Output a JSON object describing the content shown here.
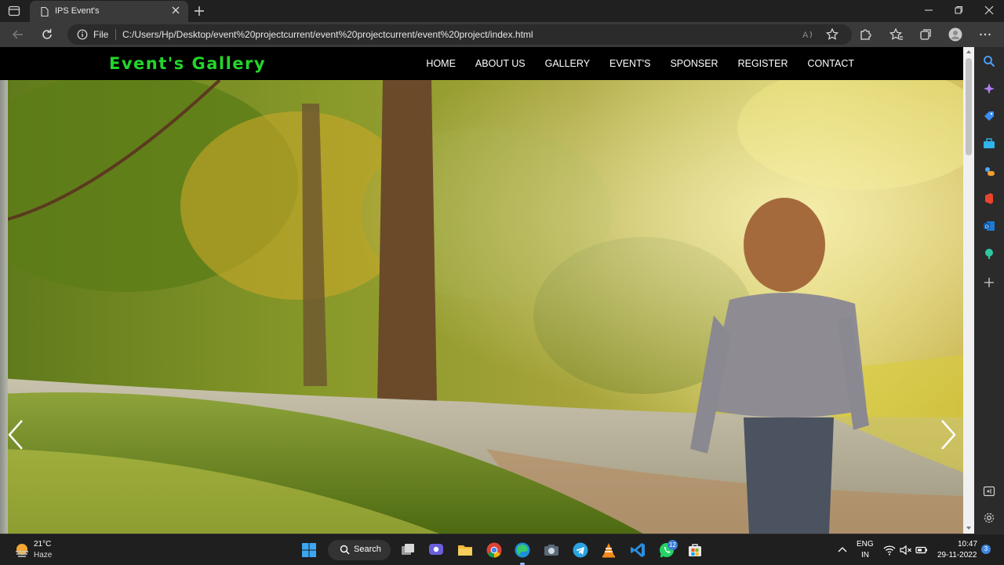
{
  "browser": {
    "tab": {
      "title": "IPS Event's"
    },
    "address": {
      "scheme_label": "File",
      "url": "C:/Users/Hp/Desktop/event%20projectcurrent/event%20projectcurrent/event%20project/index.html"
    }
  },
  "site": {
    "brand": "Event's Gallery",
    "nav": [
      "HOME",
      "ABOUT US",
      "GALLERY",
      "EVENT'S",
      "SPONSER",
      "REGISTER",
      "CONTACT"
    ],
    "brand_color": "#22d62a",
    "nav_bg": "#000000"
  },
  "taskbar": {
    "weather": {
      "temp": "21°C",
      "condition": "Haze"
    },
    "search_label": "Search",
    "whatsapp_badge": "12",
    "language": {
      "line1": "ENG",
      "line2": "IN"
    },
    "clock": {
      "time": "10:47",
      "date": "29-11-2022"
    },
    "notification_count": "3"
  }
}
